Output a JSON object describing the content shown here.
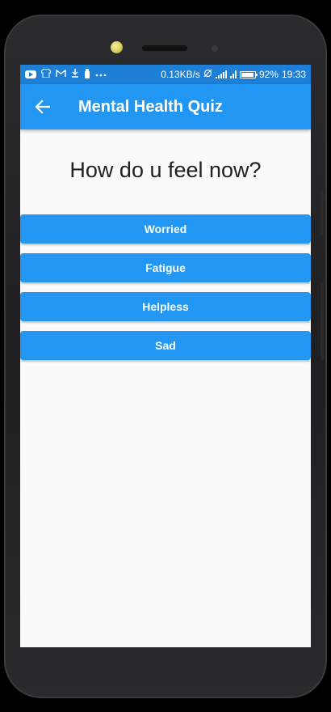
{
  "statusbar": {
    "speed": "0.13KB/s",
    "battery": "92%",
    "time": "19:33",
    "icons": [
      "youtube-icon",
      "shirt-icon",
      "gmail-icon",
      "download-icon",
      "notification-icon",
      "more-icon",
      "sync-off-icon",
      "wifi-signal-icon",
      "cell-signal-icon",
      "battery-icon"
    ]
  },
  "appbar": {
    "title": "Mental Health Quiz",
    "back_icon": "arrow-back-icon"
  },
  "quiz": {
    "question": "How do u feel now?",
    "answers": [
      "Worried",
      "Fatigue",
      "Helpless",
      "Sad"
    ]
  },
  "colors": {
    "primary": "#2196f3",
    "statusbar": "#1e7fd6",
    "background": "#fafafa",
    "question_text": "#222222"
  }
}
